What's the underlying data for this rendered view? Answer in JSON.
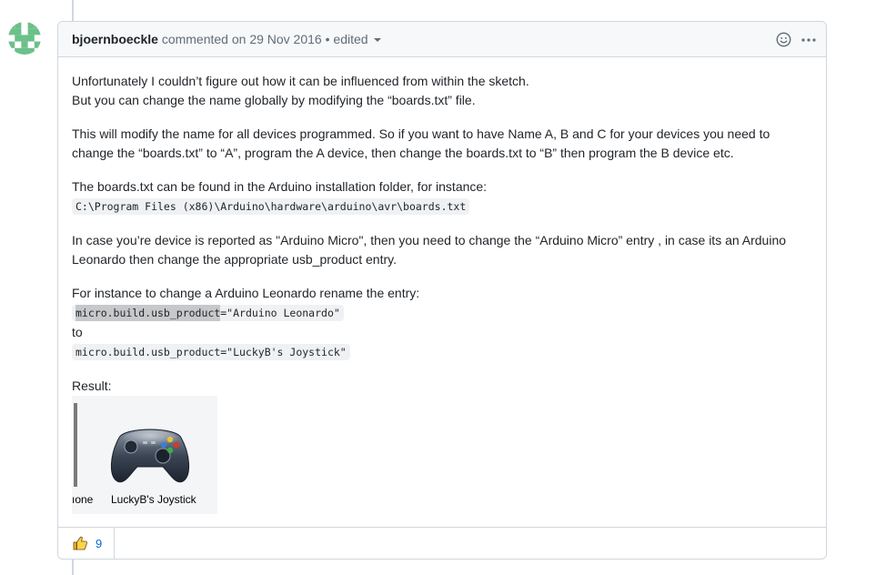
{
  "header": {
    "author": "bjoernboeckle",
    "action": "commented on",
    "date": "29 Nov 2016",
    "separator": "•",
    "edited_label": "edited",
    "icons": [
      "smiley-icon",
      "kebab-icon"
    ]
  },
  "body": {
    "p1_line1": "Unfortunately I couldn’t figure out how it can be influenced from within the sketch.",
    "p1_line2": "But you can change the name globally by modifying the “boards.txt” file.",
    "p2": "This will modify the name for all devices programmed. So if you want to have Name A, B and C for your devices you need to change the “boards.txt” to “A”, program the A device, then change the boards.txt to “B” then program the B device etc.",
    "p3_text": "The boards.txt can be found in the Arduino installation folder, for instance:",
    "p3_code": "C:\\Program Files (x86)\\Arduino\\hardware\\arduino\\avr\\boards.txt",
    "p4": "In case you’re device is reported as \"Arduino Micro\", then you need to change the “Arduino Micro” entry , in case its an Arduino Leonardo then change the appropriate usb_product entry.",
    "p5_text": "For instance to change a Arduino Leonardo rename the entry:",
    "p5_code1_key": "micro.build.usb_product",
    "p5_code1_val": "=\"Arduino Leonardo\"",
    "p5_to": "to",
    "p5_code2": "micro.build.usb_product=\"LuckyB's Joystick\"",
    "result_label": "Result:",
    "image": {
      "cut_label": "ıone",
      "device_label": "LuckyB's Joystick"
    }
  },
  "reactions": [
    {
      "icon": "thumbs-up-icon",
      "count": "9"
    }
  ],
  "colors": {
    "border": "#d0d7de",
    "header_bg": "#f6f8fa",
    "link": "#0969da",
    "muted": "#636c76"
  }
}
